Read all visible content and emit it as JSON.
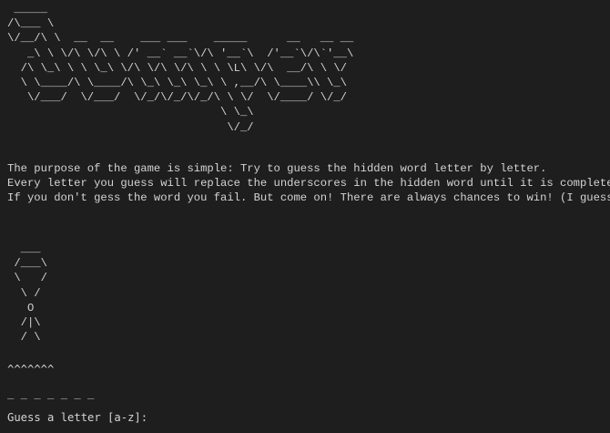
{
  "banner": {
    "art": " _____\n/\\___ \\\n\\/__/\\ \\  __  __    ___ ___    _____      __   __ __\n   _\\ \\ \\/\\ \\/\\ \\ /' __` __`\\/\\ '__`\\  /'__`\\/\\`'__\\\n  /\\ \\_\\ \\ \\ \\_\\ \\/\\ \\/\\ \\/\\ \\ \\ \\L\\ \\/\\  __/\\ \\ \\/\n  \\ \\____/\\ \\____/\\ \\_\\ \\_\\ \\_\\ \\ ,__/\\ \\____\\\\ \\_\\\n   \\/___/  \\/___/  \\/_/\\/_/\\/_/\\ \\ \\/  \\/____/ \\/_/\n                                \\ \\_\\\n                                 \\/_/"
  },
  "intro": {
    "line1": "The purpose of the game is simple: Try to guess the hidden word letter by letter.",
    "line2": "Every letter you guess will replace the underscores in the hidden word until it is completed",
    "line3": "If you don't gess the word you fail. But come on! There are always chances to win! (I guess)"
  },
  "gallows": {
    "art": "  ___\n /___\\\n \\   /\n  \\ /\n   O\n  /|\\\n  / \\"
  },
  "status": {
    "warnings": "^^^^^^^",
    "hidden_word": "_ _ _ _ _ _ _"
  },
  "prompt": {
    "label": "Guess a letter [a-z]:",
    "value": ""
  }
}
